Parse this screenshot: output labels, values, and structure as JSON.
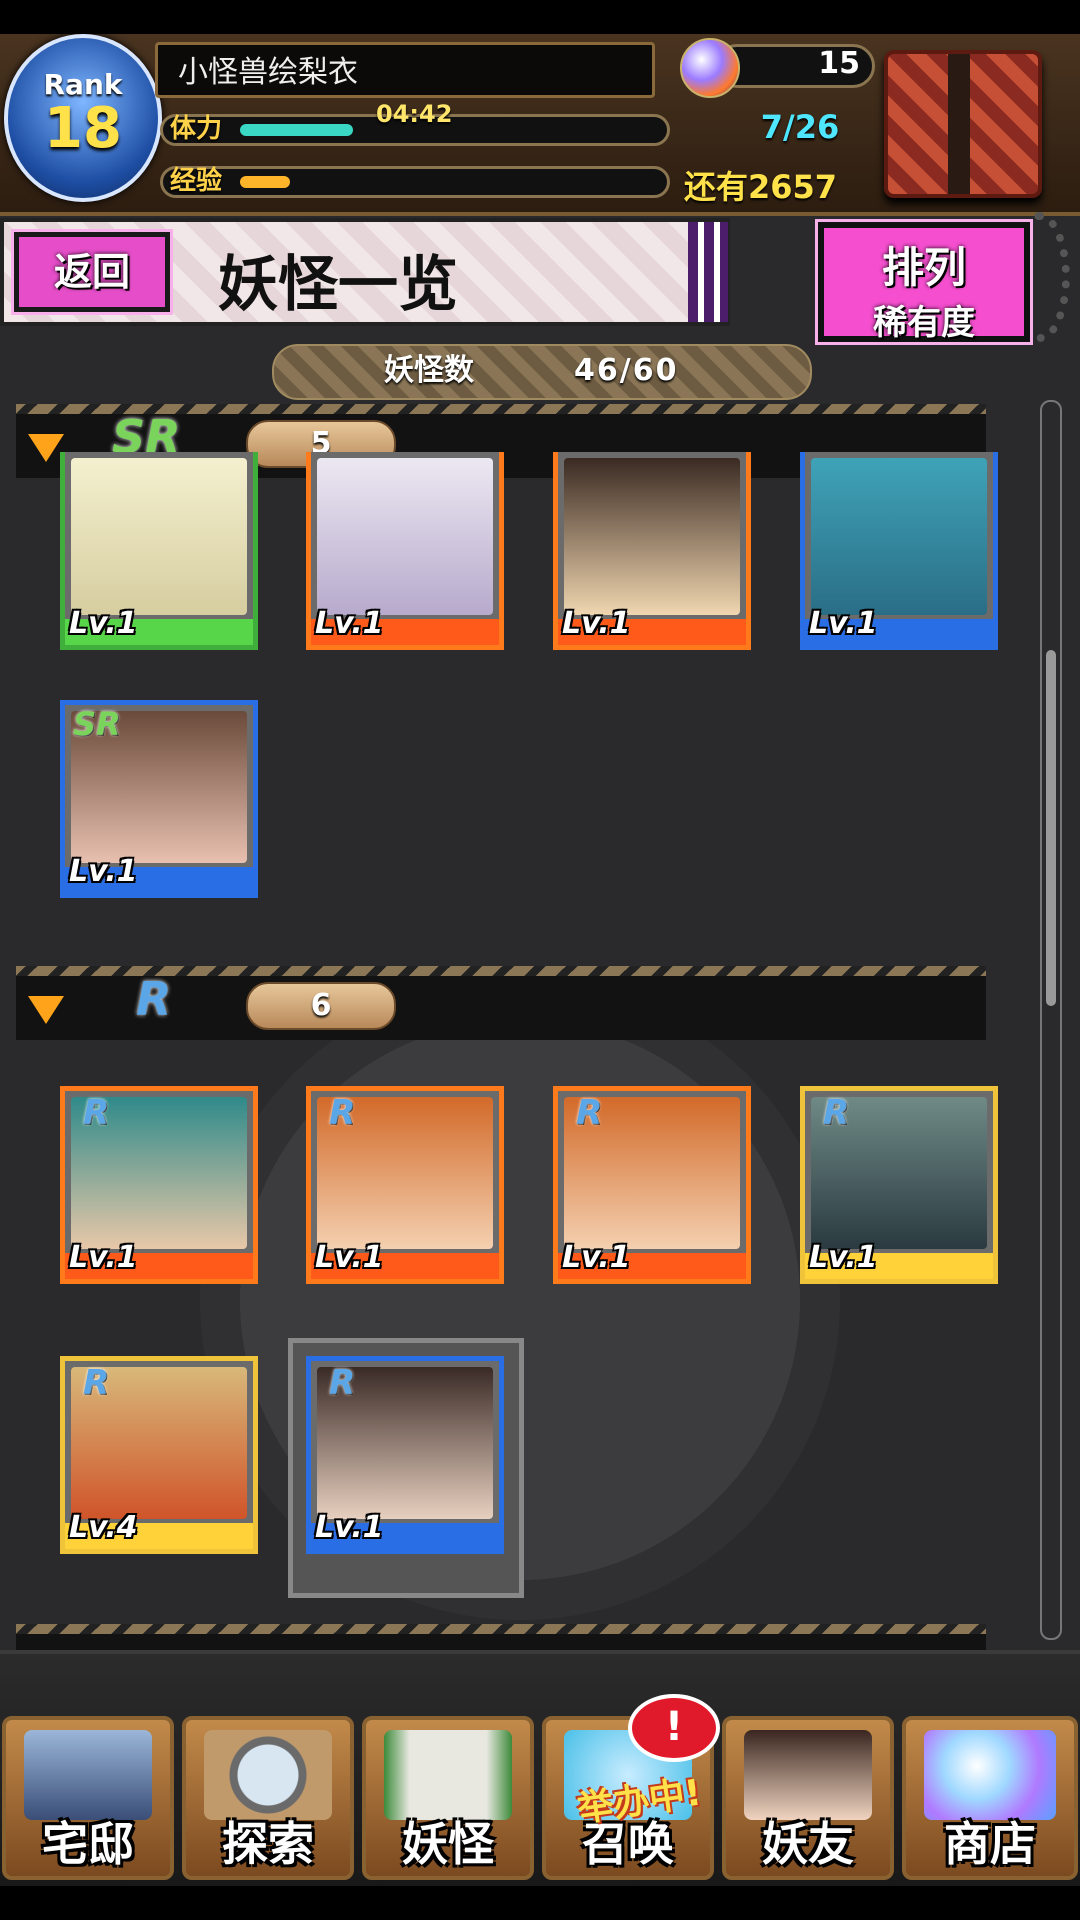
{
  "header": {
    "rank_label": "Rank",
    "rank_value": "18",
    "player_name": "小怪兽绘梨衣",
    "stamina_label": "体力",
    "stamina_timer": "04:42",
    "stamina_count": "7/26",
    "exp_label": "经验",
    "exp_remaining": "还有2657",
    "gem_count": "15",
    "stamina_fraction": 0.27,
    "exp_fraction": 0.12
  },
  "toolbar": {
    "back_label": "返回",
    "page_title": "妖怪一览",
    "sort_label_line1": "排列",
    "sort_label_line2": "稀有度"
  },
  "summary": {
    "count_label": "妖怪数",
    "count_value": "46/60"
  },
  "sections": [
    {
      "rarity": "SR",
      "count": "5",
      "cards": [
        {
          "level": "Lv.1",
          "frame": "#3fae3a",
          "bar": "#58d64a"
        },
        {
          "level": "Lv.1",
          "frame": "#ff7a1a",
          "bar": "#ff5a1a"
        },
        {
          "level": "Lv.1",
          "frame": "#ff7a1a",
          "bar": "#ff5a1a"
        },
        {
          "level": "Lv.1",
          "frame": "#2a6ee6",
          "bar": "#2a6ee6"
        },
        {
          "level": "Lv.1",
          "frame": "#2a6ee6",
          "bar": "#2a6ee6"
        }
      ]
    },
    {
      "rarity": "R",
      "count": "6",
      "cards": [
        {
          "level": "Lv.1",
          "frame": "#ff7a1a",
          "bar": "#ff5a1a"
        },
        {
          "level": "Lv.1",
          "frame": "#ff7a1a",
          "bar": "#ff5a1a"
        },
        {
          "level": "Lv.1",
          "frame": "#ff7a1a",
          "bar": "#ff5a1a"
        },
        {
          "level": "Lv.1",
          "frame": "#f0c43a",
          "bar": "#ffd23a"
        },
        {
          "level": "Lv.4",
          "frame": "#f0c43a",
          "bar": "#ffd23a"
        },
        {
          "level": "Lv.1",
          "frame": "#2a6ee6",
          "bar": "#2a6ee6"
        }
      ]
    }
  ],
  "nav": [
    {
      "label": "宅邸",
      "icon": "mansion-icon"
    },
    {
      "label": "探索",
      "icon": "magnifier-icon"
    },
    {
      "label": "妖怪",
      "icon": "scroll-icon"
    },
    {
      "label": "召唤",
      "icon": "summon-star-icon"
    },
    {
      "label": "妖友",
      "icon": "friend-icon"
    },
    {
      "label": "商店",
      "icon": "orb-icon"
    }
  ],
  "nav_event_label": "举办中!",
  "nav_badge": "!",
  "colors": {
    "accent_pink": "#f54fcf",
    "stamina": "#39d7c4",
    "exp": "#ffb52a",
    "gold_text": "#ffe14a"
  }
}
